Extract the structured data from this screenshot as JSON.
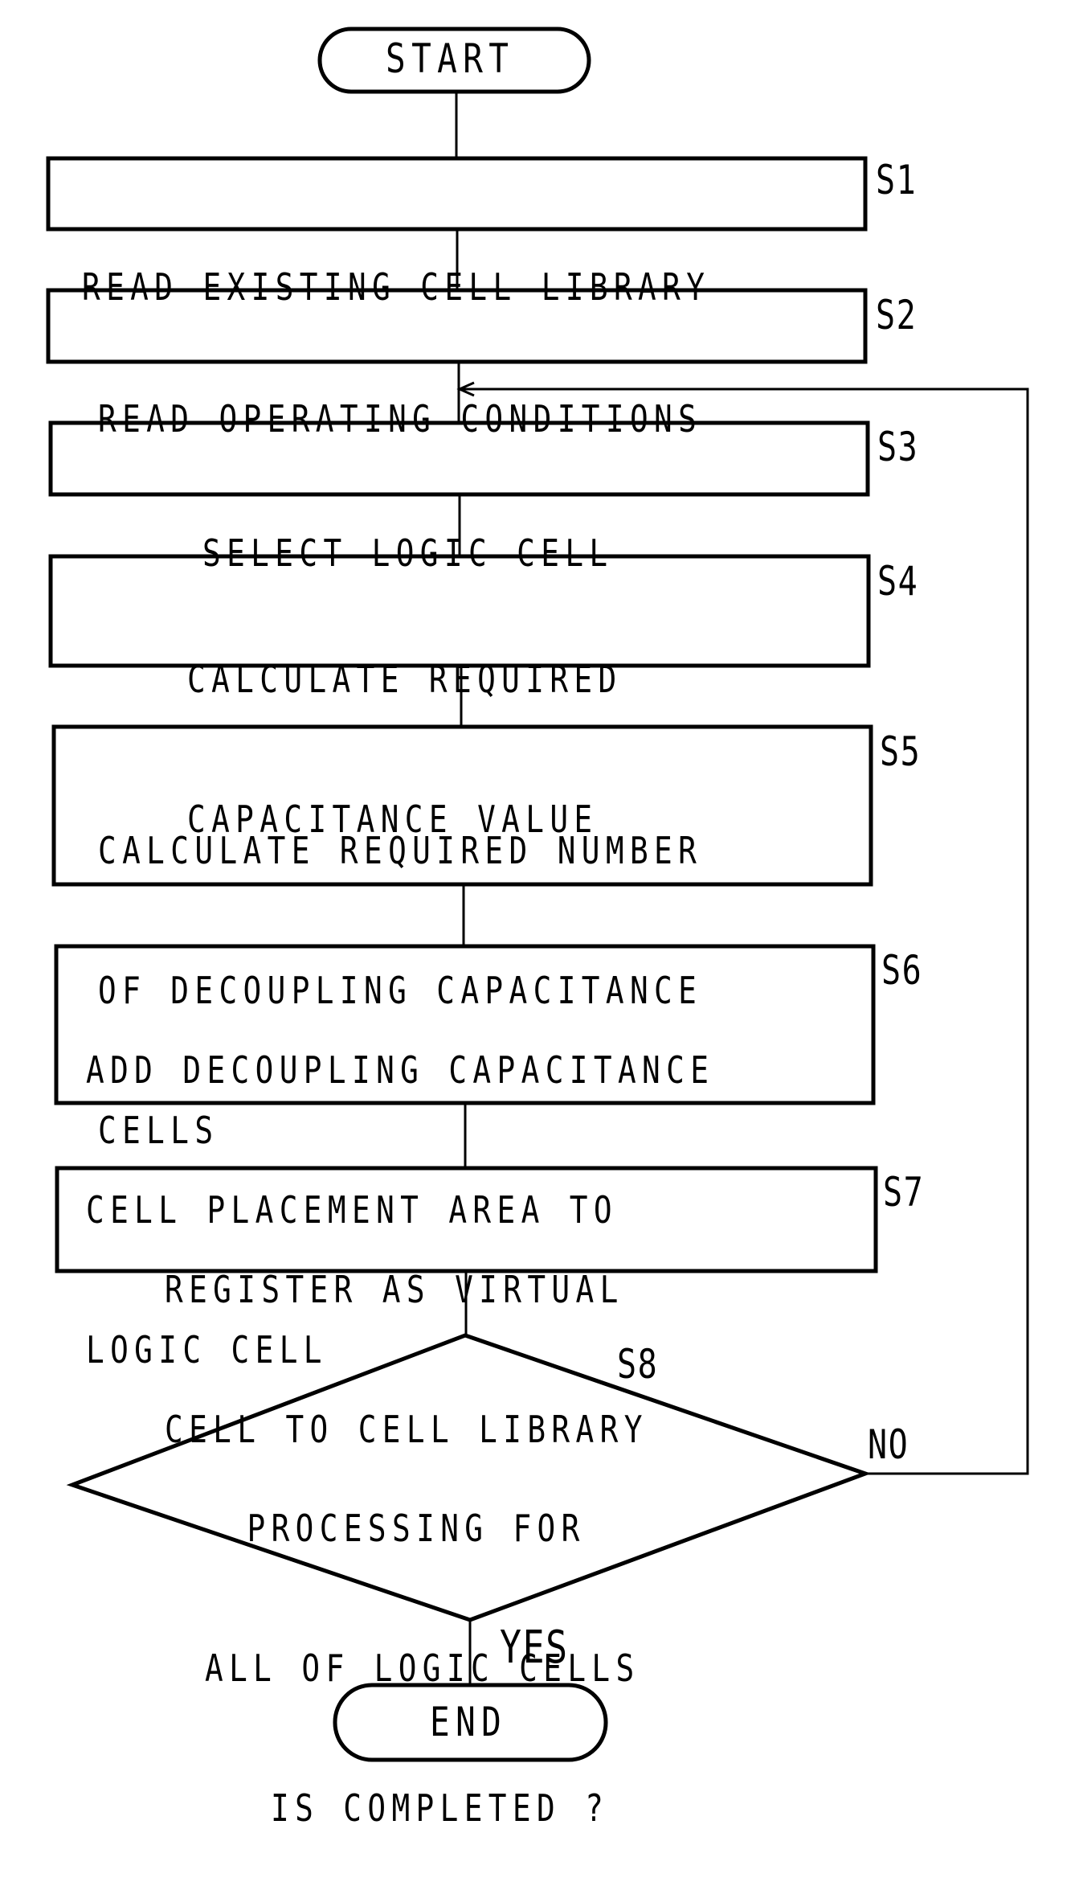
{
  "diagram": {
    "type": "flowchart",
    "start": {
      "label": "START"
    },
    "end": {
      "label": "END"
    },
    "steps": [
      {
        "id": "S1",
        "lines": [
          "READ EXISTING CELL LIBRARY"
        ]
      },
      {
        "id": "S2",
        "lines": [
          "READ OPERATING CONDITIONS"
        ]
      },
      {
        "id": "S3",
        "lines": [
          "SELECT LOGIC CELL"
        ]
      },
      {
        "id": "S4",
        "lines": [
          "CALCULATE REQUIRED",
          "CAPACITANCE VALUE"
        ]
      },
      {
        "id": "S5",
        "lines": [
          "CALCULATE REQUIRED NUMBER",
          "OF DECOUPLING CAPACITANCE",
          "CELLS"
        ]
      },
      {
        "id": "S6",
        "lines": [
          "ADD DECOUPLING CAPACITANCE",
          "CELL PLACEMENT AREA TO",
          "LOGIC CELL"
        ]
      },
      {
        "id": "S7",
        "lines": [
          "REGISTER AS VIRTUAL",
          "CELL TO CELL LIBRARY"
        ]
      }
    ],
    "decision": {
      "id": "S8",
      "lines": [
        "PROCESSING FOR",
        "ALL OF LOGIC CELLS",
        "IS COMPLETED ?"
      ],
      "yes_label": "YES",
      "no_label": "NO"
    },
    "edges": [
      {
        "from": "START",
        "to": "S1"
      },
      {
        "from": "S1",
        "to": "S2"
      },
      {
        "from": "S2",
        "to": "S3"
      },
      {
        "from": "S3",
        "to": "S4"
      },
      {
        "from": "S4",
        "to": "S5"
      },
      {
        "from": "S5",
        "to": "S6"
      },
      {
        "from": "S6",
        "to": "S7"
      },
      {
        "from": "S7",
        "to": "S8"
      },
      {
        "from": "S8",
        "to": "END",
        "label": "YES"
      },
      {
        "from": "S8",
        "to": "S3",
        "label": "NO"
      }
    ]
  }
}
